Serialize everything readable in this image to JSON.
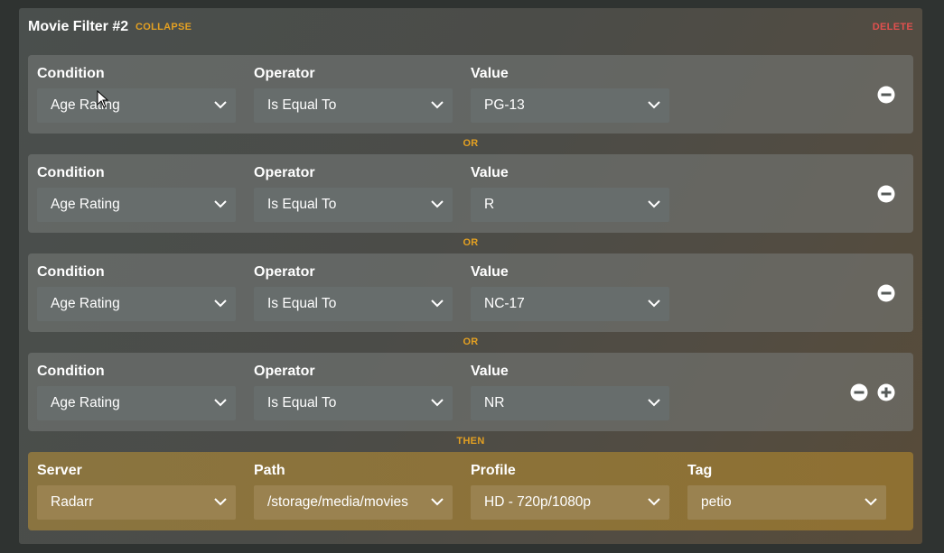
{
  "filter": {
    "title": "Movie Filter #2",
    "collapse_label": "COLLAPSE",
    "delete_label": "DELETE"
  },
  "conditions": [
    {
      "condition_label": "Condition",
      "condition_value": "Age Rating",
      "operator_label": "Operator",
      "operator_value": "Is Equal To",
      "value_label": "Value",
      "value_value": "PG-13"
    },
    {
      "condition_label": "Condition",
      "condition_value": "Age Rating",
      "operator_label": "Operator",
      "operator_value": "Is Equal To",
      "value_label": "Value",
      "value_value": "R"
    },
    {
      "condition_label": "Condition",
      "condition_value": "Age Rating",
      "operator_label": "Operator",
      "operator_value": "Is Equal To",
      "value_label": "Value",
      "value_value": "NC-17"
    },
    {
      "condition_label": "Condition",
      "condition_value": "Age Rating",
      "operator_label": "Operator",
      "operator_value": "Is Equal To",
      "value_label": "Value",
      "value_value": "NR"
    }
  ],
  "separators": [
    "OR",
    "OR",
    "OR",
    "THEN"
  ],
  "action": {
    "server_label": "Server",
    "server_value": "Radarr",
    "path_label": "Path",
    "path_value": "/storage/media/movies",
    "profile_label": "Profile",
    "profile_value": "HD - 720p/1080p",
    "tag_label": "Tag",
    "tag_value": "petio"
  },
  "icons": {
    "remove": "minus-circle-icon",
    "add": "plus-circle-icon",
    "dropdown": "chevron-down-icon"
  },
  "colors": {
    "accent": "#e3a022",
    "danger": "#e0504e"
  }
}
